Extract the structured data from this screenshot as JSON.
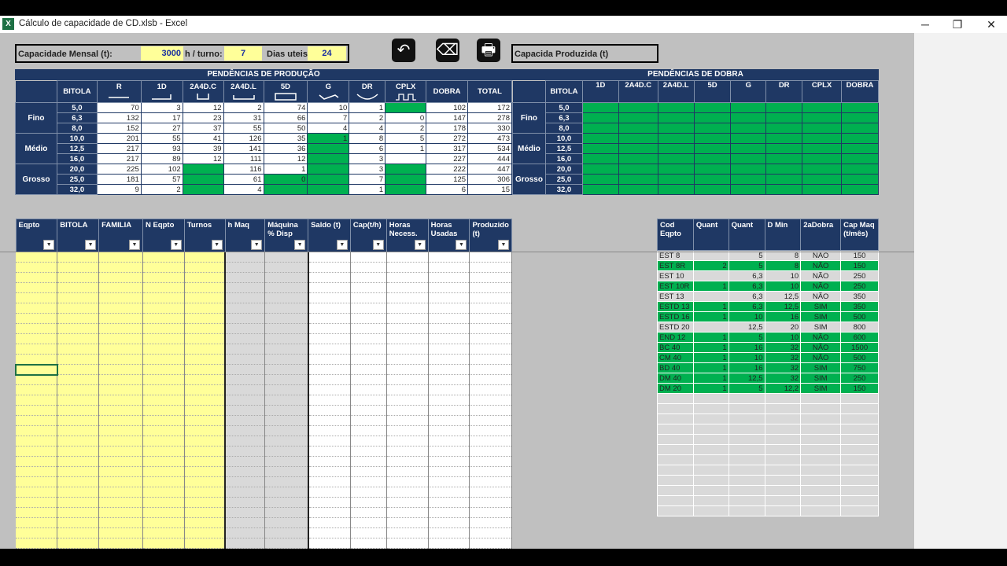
{
  "window": {
    "title": "Cálculo de capacidade de CD.xlsb - Excel",
    "app_icon": "X"
  },
  "controls": {
    "minimize": "─",
    "restore": "❐",
    "close": "✕"
  },
  "inputs": {
    "cap_label": "Capacidade Mensal (t):",
    "cap_value": "3000",
    "hturno_label": "h / turno:",
    "hturno_value": "7",
    "dias_label": "Dias uteis",
    "dias_value": "24",
    "produzida_label": "Capacida Produzida (t)"
  },
  "buttons": {
    "undo": "↶",
    "eraser": "⌫",
    "print": "🖶"
  },
  "producao": {
    "title": "PENDÊNCIAS DE PRODUÇÃO",
    "headers": [
      "BITOLA",
      "R",
      "1D",
      "2A4D.C",
      "2A4D.L",
      "5D",
      "G",
      "DR",
      "CPLX",
      "DOBRA",
      "TOTAL"
    ],
    "groups": [
      "Fino",
      "Médio",
      "Grosso"
    ],
    "rows": [
      {
        "bitola": "5,0",
        "v": [
          "70",
          "3",
          "12",
          "2",
          "74",
          "10",
          "1",
          "",
          "102",
          "172"
        ]
      },
      {
        "bitola": "6,3",
        "v": [
          "132",
          "17",
          "23",
          "31",
          "66",
          "7",
          "2",
          "0",
          "147",
          "278"
        ]
      },
      {
        "bitola": "8,0",
        "v": [
          "152",
          "27",
          "37",
          "55",
          "50",
          "4",
          "4",
          "2",
          "178",
          "330"
        ]
      },
      {
        "bitola": "10,0",
        "v": [
          "201",
          "55",
          "41",
          "126",
          "35",
          "1",
          "8",
          "5",
          "272",
          "473"
        ]
      },
      {
        "bitola": "12,5",
        "v": [
          "217",
          "93",
          "39",
          "141",
          "36",
          "",
          "6",
          "1",
          "317",
          "534"
        ]
      },
      {
        "bitola": "16,0",
        "v": [
          "217",
          "89",
          "12",
          "111",
          "12",
          "",
          "3",
          "",
          "227",
          "444"
        ]
      },
      {
        "bitola": "20,0",
        "v": [
          "225",
          "102",
          "",
          "116",
          "1",
          "",
          "3",
          "",
          "222",
          "447"
        ]
      },
      {
        "bitola": "25,0",
        "v": [
          "181",
          "57",
          "",
          "61",
          "0",
          "",
          "7",
          "",
          "125",
          "306"
        ]
      },
      {
        "bitola": "32,0",
        "v": [
          "9",
          "2",
          "",
          "4",
          "",
          "",
          "1",
          "",
          "6",
          "15"
        ]
      }
    ]
  },
  "dobra": {
    "title": "PENDÊNCIAS DE DOBRA",
    "headers": [
      "BITOLA",
      "1D",
      "2A4D.C",
      "2A4D.L",
      "5D",
      "G",
      "DR",
      "CPLX",
      "DOBRA"
    ],
    "groups": [
      "Fino",
      "Médio",
      "Grosso"
    ],
    "bitolas": [
      "5,0",
      "6,3",
      "8,0",
      "10,0",
      "12,5",
      "16,0",
      "20,0",
      "25,0",
      "32,0"
    ]
  },
  "lower_headers": [
    "Eqpto",
    "BITOLA",
    "FAMILIA",
    "N Eqpto",
    "Turnos",
    "h Maq",
    "Máquina % Disp",
    "Saldo (t)",
    "Cap(t/h)",
    "Horas Necess.",
    "Horas Usadas",
    "Produzido (t)"
  ],
  "cod_table": {
    "headers": [
      "Cod Eqpto",
      "Quant",
      "Quant",
      "D Min",
      "2aDobra",
      "Cap Maq (t/mês)"
    ],
    "rows": [
      {
        "cod": "EST 8",
        "q1": "",
        "q2": "5",
        "dmin": "8",
        "dobra": "NÃO",
        "cap": "150",
        "green": false
      },
      {
        "cod": "EST 8R",
        "q1": "2",
        "q2": "5",
        "dmin": "8",
        "dobra": "NÃO",
        "cap": "150",
        "green": true
      },
      {
        "cod": "EST 10",
        "q1": "",
        "q2": "6,3",
        "dmin": "10",
        "dobra": "NÃO",
        "cap": "250",
        "green": false
      },
      {
        "cod": "EST 10R",
        "q1": "1",
        "q2": "6,3",
        "dmin": "10",
        "dobra": "NÃO",
        "cap": "250",
        "green": true
      },
      {
        "cod": "EST 13",
        "q1": "",
        "q2": "6,3",
        "dmin": "12,5",
        "dobra": "NÃO",
        "cap": "350",
        "green": false
      },
      {
        "cod": "ESTD 13",
        "q1": "1",
        "q2": "6,3",
        "dmin": "12,5",
        "dobra": "SIM",
        "cap": "350",
        "green": true
      },
      {
        "cod": "ESTD 16",
        "q1": "1",
        "q2": "10",
        "dmin": "16",
        "dobra": "SIM",
        "cap": "500",
        "green": true
      },
      {
        "cod": "ESTD 20",
        "q1": "",
        "q2": "12,5",
        "dmin": "20",
        "dobra": "SIM",
        "cap": "800",
        "green": false
      },
      {
        "cod": "END 12",
        "q1": "1",
        "q2": "5",
        "dmin": "10",
        "dobra": "NÃO",
        "cap": "600",
        "green": true
      },
      {
        "cod": "BC 40",
        "q1": "1",
        "q2": "16",
        "dmin": "32",
        "dobra": "NÃO",
        "cap": "1500",
        "green": true
      },
      {
        "cod": "CM 40",
        "q1": "1",
        "q2": "10",
        "dmin": "32",
        "dobra": "NÃO",
        "cap": "500",
        "green": true
      },
      {
        "cod": "BD 40",
        "q1": "1",
        "q2": "16",
        "dmin": "32",
        "dobra": "SIM",
        "cap": "750",
        "green": true
      },
      {
        "cod": "DM 40",
        "q1": "1",
        "q2": "12,5",
        "dmin": "32",
        "dobra": "SIM",
        "cap": "250",
        "green": true
      },
      {
        "cod": "DM 20",
        "q1": "1",
        "q2": "5",
        "dmin": "12,2",
        "dobra": "SIM",
        "cap": "150",
        "green": true
      }
    ]
  }
}
